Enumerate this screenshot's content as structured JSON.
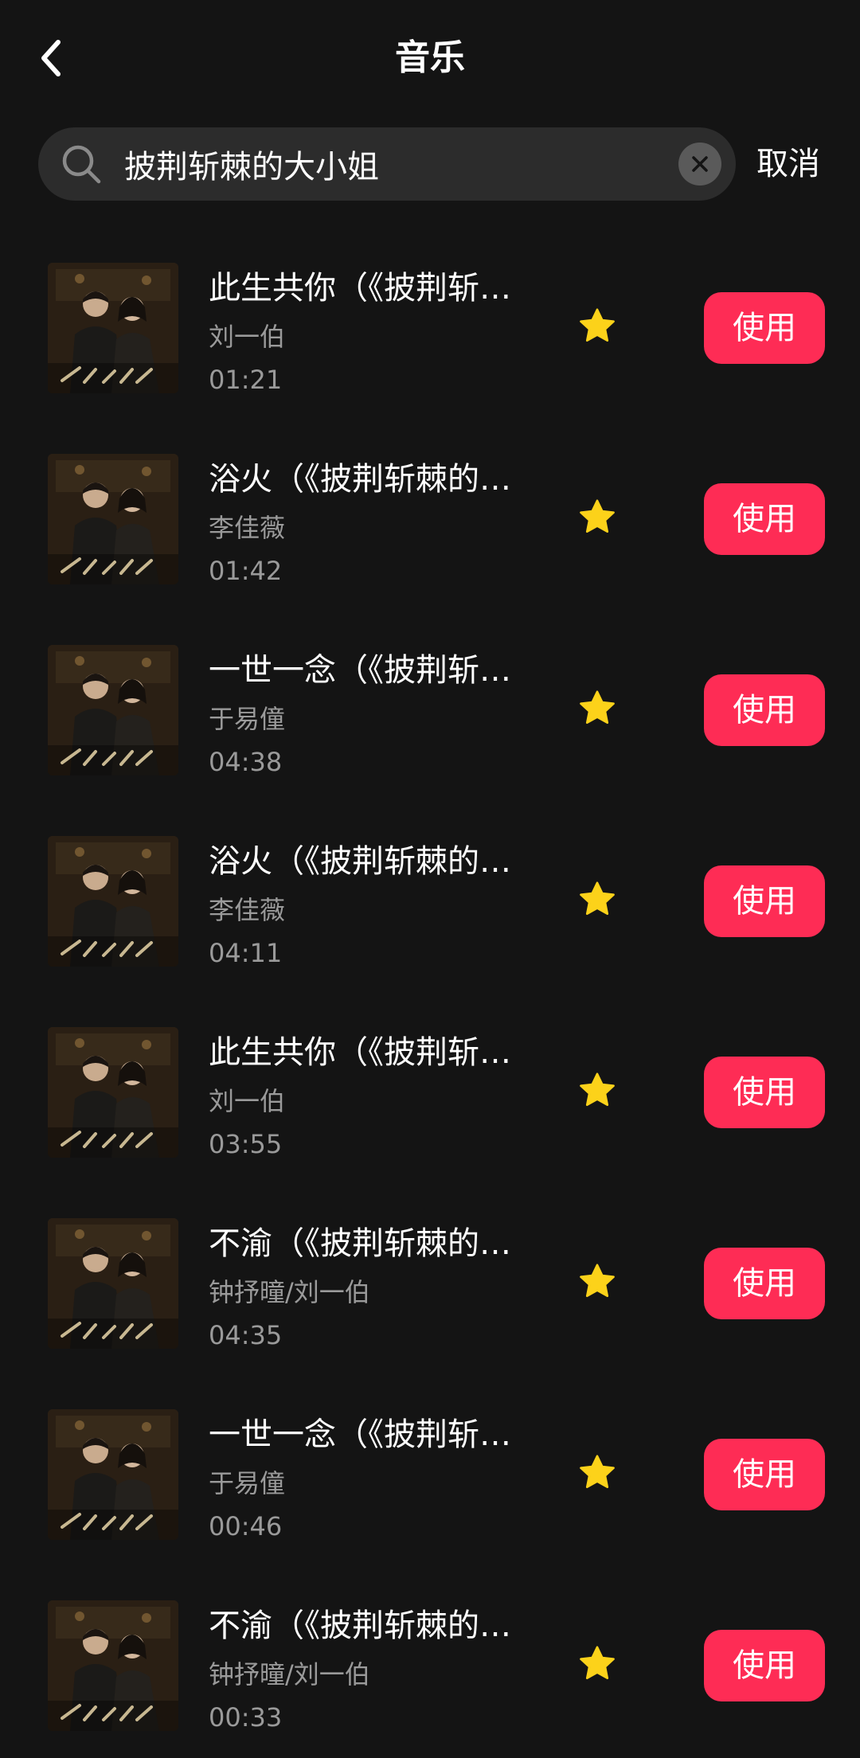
{
  "header": {
    "title": "音乐"
  },
  "search": {
    "value": "披荆斩棘的大小姐",
    "cancel_label": "取消"
  },
  "colors": {
    "background": "#141414",
    "search_bg": "#2c2c2c",
    "accent": "#fe2c55",
    "star": "#fcd21a",
    "secondary_text": "#9a9a9a"
  },
  "icons": {
    "back": "chevron-left-icon",
    "search": "search-icon",
    "clear": "close-circle-icon",
    "favorite": "star-icon"
  },
  "songs": [
    {
      "title": "此生共你（《披荆斩…",
      "artist": "刘一伯",
      "duration": "01:21",
      "action_label": "使用"
    },
    {
      "title": "浴火（《披荆斩棘的…",
      "artist": "李佳薇",
      "duration": "01:42",
      "action_label": "使用"
    },
    {
      "title": "一世一念（《披荆斩…",
      "artist": "于易僮",
      "duration": "04:38",
      "action_label": "使用"
    },
    {
      "title": "浴火（《披荆斩棘的…",
      "artist": "李佳薇",
      "duration": "04:11",
      "action_label": "使用"
    },
    {
      "title": "此生共你（《披荆斩…",
      "artist": "刘一伯",
      "duration": "03:55",
      "action_label": "使用"
    },
    {
      "title": "不渝（《披荆斩棘的…",
      "artist": "钟抒曈/刘一伯",
      "duration": "04:35",
      "action_label": "使用"
    },
    {
      "title": "一世一念（《披荆斩…",
      "artist": "于易僮",
      "duration": "00:46",
      "action_label": "使用"
    },
    {
      "title": "不渝（《披荆斩棘的…",
      "artist": "钟抒曈/刘一伯",
      "duration": "00:33",
      "action_label": "使用"
    }
  ]
}
